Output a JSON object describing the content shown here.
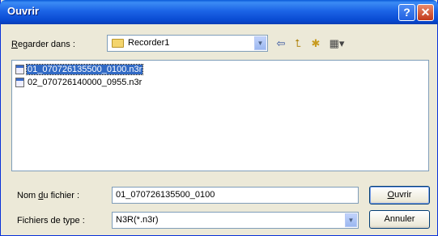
{
  "window": {
    "title": "Ouvrir"
  },
  "look_in": {
    "label_accel": "R",
    "label_rest": "egarder dans :",
    "value": "Recorder1"
  },
  "toolbar": {
    "back_icon": "⇦",
    "up_icon": "⮤",
    "new_folder_icon": "✱",
    "views_icon": "▦▾"
  },
  "files": [
    {
      "name": "01_070726135500_0100.n3r",
      "selected": true
    },
    {
      "name": "02_070726140000_0955.n3r",
      "selected": false
    }
  ],
  "filename": {
    "label_pre": "Nom ",
    "label_accel": "d",
    "label_post": "u fichier :",
    "value": "01_070726135500_0100"
  },
  "filetype": {
    "label": "Fichiers de type :",
    "value": "N3R(*.n3r)"
  },
  "buttons": {
    "open_accel": "O",
    "open_rest": "uvrir",
    "cancel": "Annuler"
  },
  "colors": {
    "titlebar": "#0a5ad8",
    "selection": "#316ac5",
    "dialog_bg": "#ece9d8"
  }
}
